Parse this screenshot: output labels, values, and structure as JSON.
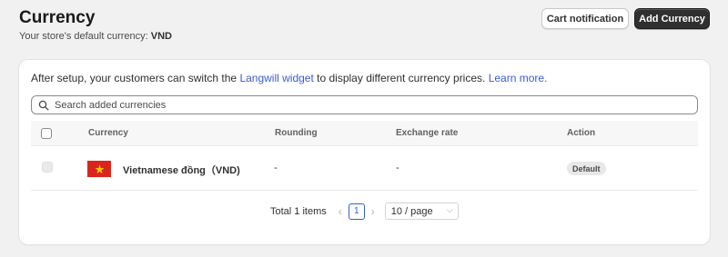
{
  "header": {
    "title": "Currency",
    "subtitle_prefix": "Your store's default currency: ",
    "default_currency": "VND",
    "cart_notification_label": "Cart notification",
    "add_currency_label": "Add Currency"
  },
  "info": {
    "text_before": "After setup, your customers can switch the ",
    "widget_link": "Langwill widget",
    "text_after": " to display different currency prices. ",
    "learn_more": "Learn more."
  },
  "search": {
    "placeholder": "Search added currencies",
    "value": ""
  },
  "table": {
    "columns": [
      "Currency",
      "Rounding",
      "Exchange rate",
      "Action"
    ],
    "rows": [
      {
        "currency": "Vietnamese đồng（VND)",
        "rounding": "-",
        "exchange_rate": "-",
        "action": "Default",
        "flag": "vietnam-flag-icon"
      }
    ]
  },
  "pagination": {
    "total_text": "Total 1 items",
    "current_page": "1",
    "page_size": "10 / page"
  },
  "colors": {
    "background": "#f1f1f1",
    "primary_button": "#303030",
    "link": "#3b5bd6",
    "flag_red": "#da251d",
    "flag_star": "#ffcd00"
  }
}
